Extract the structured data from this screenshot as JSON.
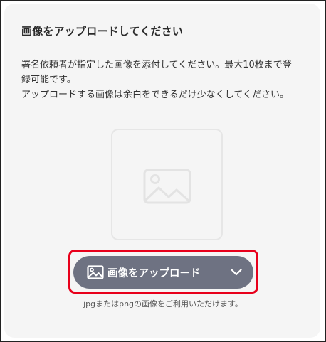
{
  "dialog": {
    "title": "画像をアップロードしてください",
    "description_lines": [
      "署名依頼者が指定した画像を添付してください。最大10枚まで登",
      "録可能です。",
      "アップロードする画像は余白をできるだけ少なくしてください。"
    ]
  },
  "placeholder": {
    "icon": "image-icon"
  },
  "upload": {
    "button_label": "画像をアップロード",
    "button_icon": "image-icon",
    "menu_icon": "chevron-down-icon",
    "hint": "jpgまたはpngの画像をご利用いただけます。"
  },
  "colors": {
    "button_bg": "#6e7282",
    "highlight_border": "#e8001b",
    "card_bg": "#f5f5f5"
  }
}
